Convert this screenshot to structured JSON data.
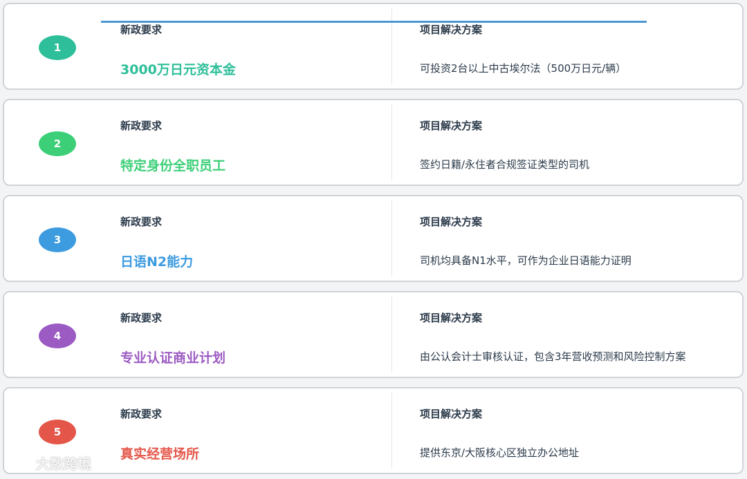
{
  "cards": [
    {
      "number": "1",
      "color": "#2ebf9a",
      "left_label": "新政要求",
      "left_value": "3000万日元资本金",
      "right_label": "项目解决方案",
      "right_value": "可投资2台以上中古埃尔法（500万日元/辆）"
    },
    {
      "number": "2",
      "color": "#3ccf78",
      "left_label": "新政要求",
      "left_value": "特定身份全职员工",
      "right_label": "项目解决方案",
      "right_value": "签约日籍/永住者合规签证类型的司机"
    },
    {
      "number": "3",
      "color": "#3d9be0",
      "left_label": "新政要求",
      "left_value": "日语N2能力",
      "right_label": "项目解决方案",
      "right_value": "司机均具备N1水平，可作为企业日语能力证明"
    },
    {
      "number": "4",
      "color": "#9b5bc2",
      "left_label": "新政要求",
      "left_value": "专业认证商业计划",
      "right_label": "项目解决方案",
      "right_value": "由公认会计士审核认证，包含3年营收预测和风险控制方案"
    },
    {
      "number": "5",
      "color": "#e4564a",
      "left_label": "新政要求",
      "left_value": "真实经营场所",
      "right_label": "项目解决方案",
      "right_value": "提供东京/大阪核心区独立办公地址"
    }
  ],
  "watermark": {
    "text": "大数跨境",
    "icon": "logo-icon"
  }
}
